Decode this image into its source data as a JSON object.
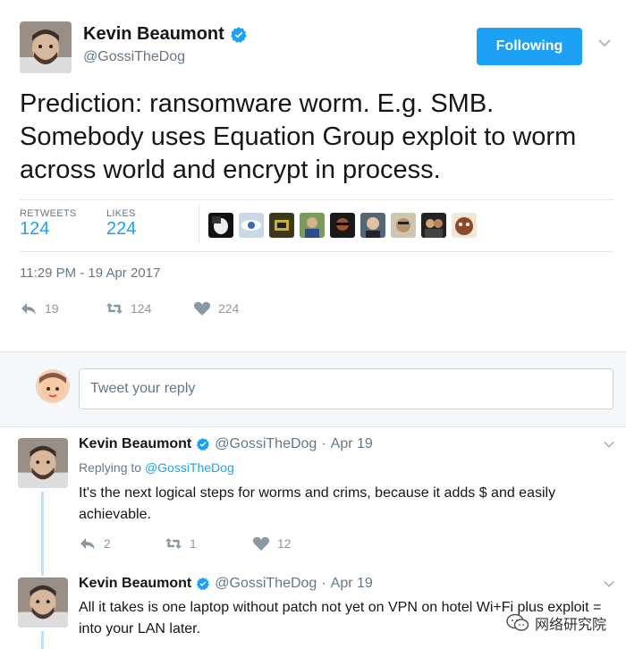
{
  "main_tweet": {
    "author_name": "Kevin Beaumont",
    "handle": "@GossiTheDog",
    "follow_label": "Following",
    "text": "Prediction: ransomware worm. E.g. SMB. Somebody uses Equation Group exploit to worm across world and encrypt in process.",
    "stats": {
      "retweets_label": "RETWEETS",
      "retweets": "124",
      "likes_label": "LIKES",
      "likes": "224"
    },
    "liker_avatars": [
      "liker-1",
      "liker-2",
      "liker-3",
      "liker-4",
      "liker-5",
      "liker-6",
      "liker-7",
      "liker-8",
      "liker-9"
    ],
    "timestamp": "11:29 PM - 19 Apr 2017",
    "actions": {
      "replies": "19",
      "retweets": "124",
      "likes": "224"
    }
  },
  "reply_box": {
    "placeholder": "Tweet your reply"
  },
  "replies": [
    {
      "author_name": "Kevin Beaumont",
      "handle": "@GossiTheDog",
      "separator": "·",
      "date": "Apr 19",
      "replying_prefix": "Replying to",
      "replying_to": "@GossiTheDog",
      "text": "It's the next logical steps for worms and crims, because it adds $ and easily achievable.",
      "actions": {
        "replies": "2",
        "retweets": "1",
        "likes": "12"
      }
    },
    {
      "author_name": "Kevin Beaumont",
      "handle": "@GossiTheDog",
      "separator": "·",
      "date": "Apr 19",
      "text": "All it takes is one laptop without patch not yet on VPN on hotel Wi+Fi plus exploit = into your LAN later."
    }
  ],
  "watermark": {
    "text": "网络研究院"
  },
  "colors": {
    "accent": "#1da1f2",
    "muted": "#657786",
    "icon": "#8899a6",
    "verified": "#1da1f2"
  }
}
